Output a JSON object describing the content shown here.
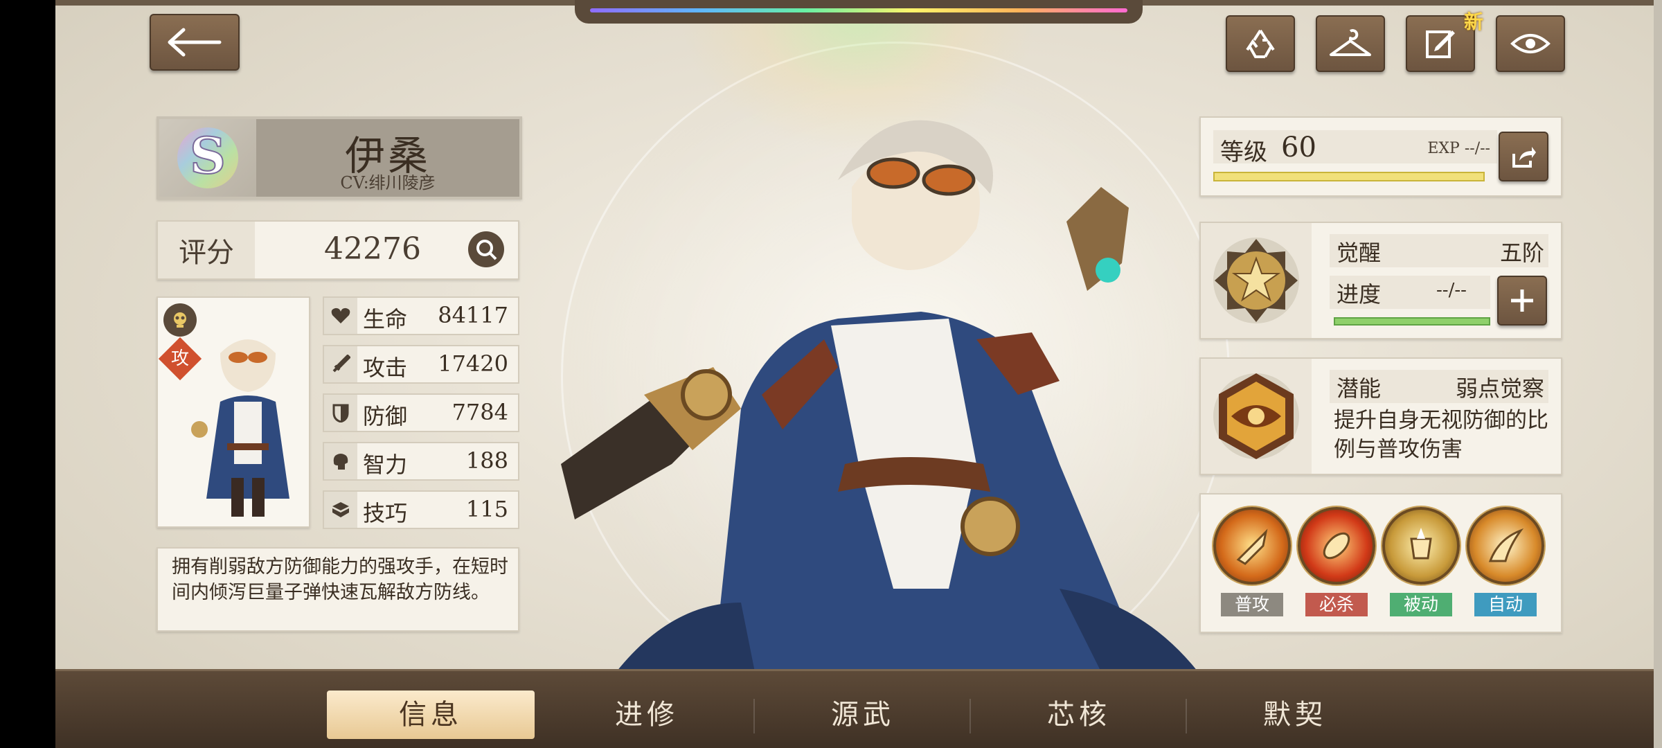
{
  "header": {
    "back_label": "←",
    "new_badge": "新"
  },
  "hero": {
    "name": "伊桑",
    "cv": "CV:绯川陵彦",
    "rank": "S"
  },
  "score": {
    "label": "评分",
    "value": "42276"
  },
  "portrait": {
    "role_tag": "攻"
  },
  "stats": [
    {
      "label": "生命",
      "value": "84117",
      "icon": "heart-icon"
    },
    {
      "label": "攻击",
      "value": "17420",
      "icon": "sword-icon"
    },
    {
      "label": "防御",
      "value": "7784",
      "icon": "shield-icon"
    },
    {
      "label": "智力",
      "value": "188",
      "icon": "brain-icon"
    },
    {
      "label": "技巧",
      "value": "115",
      "icon": "box-icon"
    }
  ],
  "description": "拥有削弱敌方防御能力的强攻手，在短时间内倾泻巨量子弹快速瓦解敌方防线。",
  "level": {
    "label": "等级",
    "value": "60",
    "exp": "EXP --/--",
    "progress": 1.0
  },
  "awakening": {
    "label": "觉醒",
    "value": "五阶",
    "progress_label": "进度",
    "progress_value": "--/--",
    "progress": 1.0
  },
  "potential": {
    "label": "潜能",
    "name": "弱点觉察",
    "desc": "提升自身无视防御的比例与普攻伤害"
  },
  "skills": [
    {
      "tag": "普攻",
      "color": "#8d8980"
    },
    {
      "tag": "必杀",
      "color": "#c25a4e"
    },
    {
      "tag": "被动",
      "color": "#4fae72"
    },
    {
      "tag": "自动",
      "color": "#3f9bbf"
    }
  ],
  "tabs": [
    "信息",
    "进修",
    "源武",
    "芯核",
    "默契"
  ],
  "active_tab": 0
}
